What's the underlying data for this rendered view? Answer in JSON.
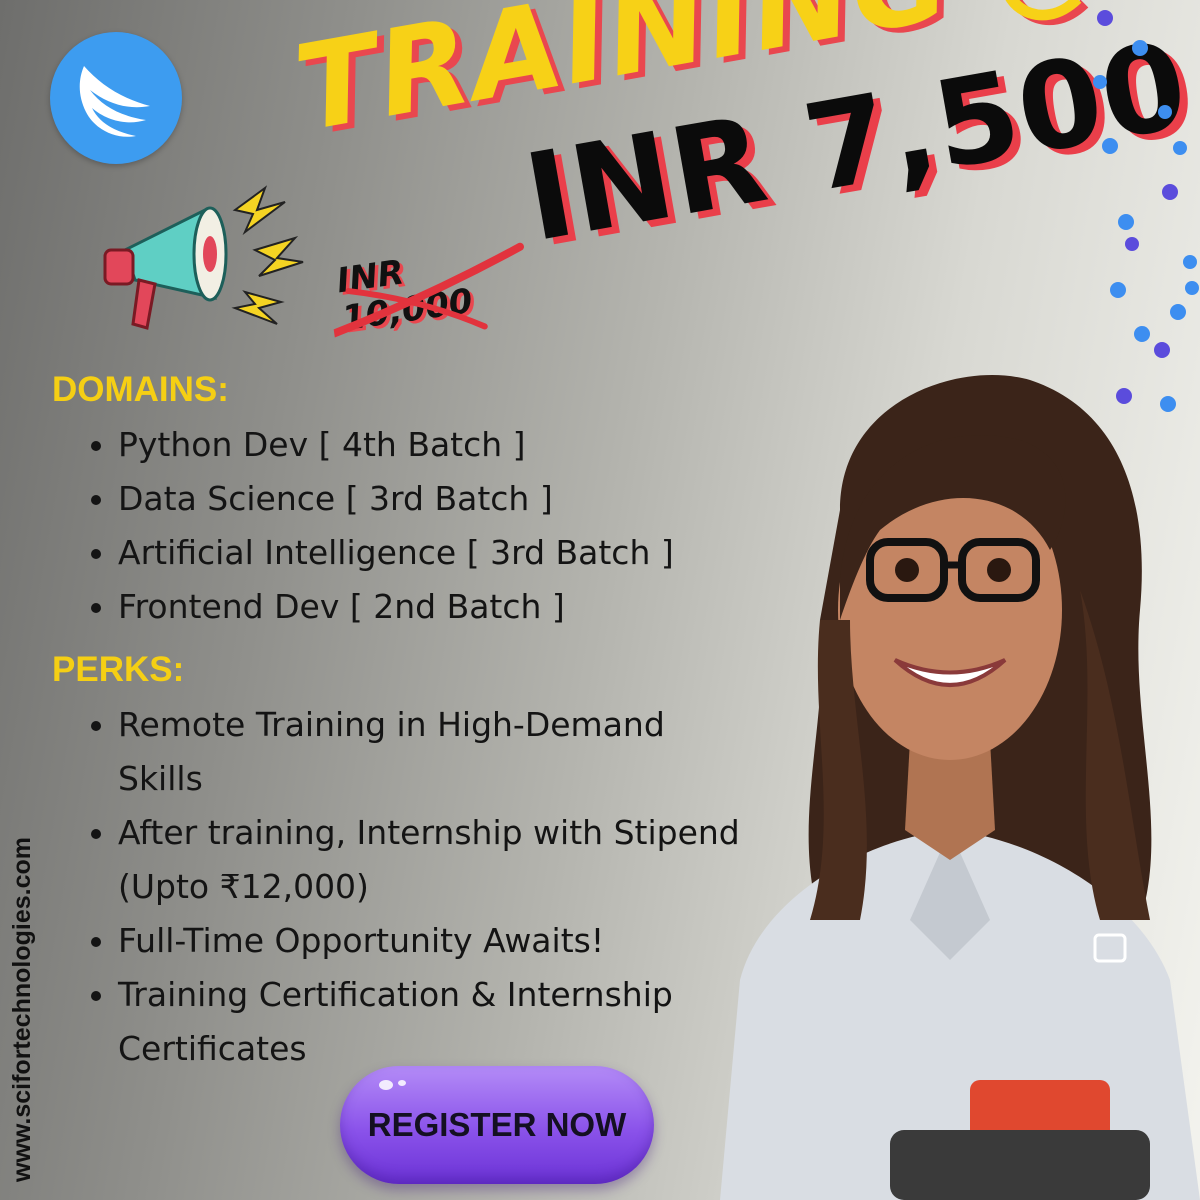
{
  "brand": {
    "logo_icon": "wing-logo-icon",
    "website": "www.scifortechnologies.com"
  },
  "headline": {
    "training": "TRAINING @",
    "price": "INR 7,500",
    "old_price_line1": "INR",
    "old_price_line2": "10,000"
  },
  "domains": {
    "heading": "DOMAINS:",
    "items": [
      {
        "label": "Python Dev [ 4th Batch ]"
      },
      {
        "label": "Data Science [ 3rd Batch ]"
      },
      {
        "label": "Artificial Intelligence [ 3rd Batch ]"
      },
      {
        "label": "Frontend Dev [ 2nd Batch ]"
      }
    ]
  },
  "perks": {
    "heading": "PERKS:",
    "items": [
      {
        "label": "Remote Training in High-Demand Skills"
      },
      {
        "label": "After training, Internship with Stipend (Upto ₹12,000)"
      },
      {
        "label": "Full-Time Opportunity Awaits!"
      },
      {
        "label": "Training Certification & Internship Certificates"
      }
    ]
  },
  "cta": {
    "register_label": "REGISTER NOW"
  },
  "colors": {
    "accent_yellow": "#f7d117",
    "accent_red": "#e9474f",
    "logo_blue": "#3d9cf0",
    "button_purple": "#8a52ea",
    "dot_blue": "#3d8ef0",
    "dot_purple": "#5b4cdc"
  },
  "icons": [
    "wing-logo-icon",
    "megaphone-icon",
    "confetti-dots"
  ]
}
